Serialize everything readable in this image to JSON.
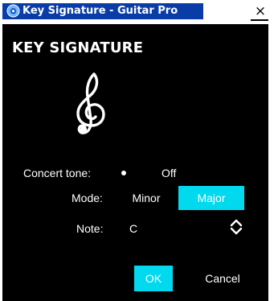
{
  "window": {
    "title": "Key Signature - Guitar Pro",
    "close_glyph": "×",
    "app_icon": "guitar-pro-logo-icon",
    "close_icon": "close-icon"
  },
  "dialog": {
    "heading": "KEY SIGNATURE",
    "clef_icon": "treble-clef-icon",
    "concert_tone": {
      "label": "Concert tone:",
      "value": "Off"
    },
    "mode": {
      "label": "Mode:",
      "options": [
        "Minor",
        "Major"
      ],
      "selected": "Major"
    },
    "note": {
      "label": "Note:",
      "value": "C",
      "spinner_icon": "up-down-chevron-icon"
    },
    "buttons": {
      "ok": "OK",
      "cancel": "Cancel"
    }
  },
  "colors": {
    "accent": "#00d9ee",
    "panel_background": "#000000",
    "title_highlight": "#0a3ca8",
    "text": "#ffffff"
  }
}
